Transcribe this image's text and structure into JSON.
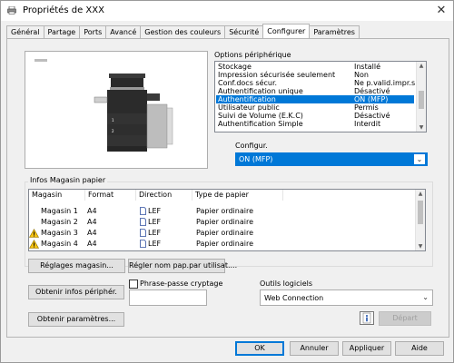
{
  "window": {
    "title": "Propriétés de XXX",
    "close_glyph": "✕"
  },
  "tabs": [
    "Général",
    "Partage",
    "Ports",
    "Avancé",
    "Gestion des couleurs",
    "Sécurité",
    "Configurer",
    "Paramètres"
  ],
  "active_tab": "Configurer",
  "options": {
    "label": "Options périphérique",
    "rows": [
      {
        "name": "Stockage",
        "value": "Installé"
      },
      {
        "name": "Impression sécurisée seulement",
        "value": "Non"
      },
      {
        "name": "Conf.docs sécur.",
        "value": "Ne p.valid.impr.s..."
      },
      {
        "name": "Authentification unique",
        "value": "Désactivé"
      },
      {
        "name": "Authentification",
        "value": "ON (MFP)"
      },
      {
        "name": "Utilisateur public",
        "value": "Permis"
      },
      {
        "name": "Suivi de Volume (E.K.C)",
        "value": "Désactivé"
      },
      {
        "name": "Authentification Simple",
        "value": "Interdit"
      }
    ],
    "selected_index": 4
  },
  "configure": {
    "label": "Configur.",
    "value": "ON (MFP)"
  },
  "trays": {
    "label": "Infos Magasin papier",
    "columns": [
      "Magasin",
      "Format",
      "Direction",
      "Type de papier"
    ],
    "rows": [
      {
        "tray": "Magasin 1",
        "format": "A4",
        "direction": "LEF",
        "type": "Papier ordinaire",
        "warning": false
      },
      {
        "tray": "Magasin 2",
        "format": "A4",
        "direction": "LEF",
        "type": "Papier ordinaire",
        "warning": false
      },
      {
        "tray": "Magasin 3",
        "format": "A4",
        "direction": "LEF",
        "type": "Papier ordinaire",
        "warning": true
      },
      {
        "tray": "Magasin 4",
        "format": "A4",
        "direction": "LEF",
        "type": "Papier ordinaire",
        "warning": true
      }
    ]
  },
  "buttons": {
    "tray_settings": "Réglages magasin...",
    "user_paper_name": "Régler nom pap.par utilisat....",
    "get_device_info": "Obtenir infos périphér.",
    "get_settings": "Obtenir paramètres...",
    "start": "Départ",
    "ok": "OK",
    "cancel": "Annuler",
    "apply": "Appliquer",
    "help": "Aide"
  },
  "passphrase": {
    "label": "Phrase-passe cryptage",
    "checked": false,
    "value": ""
  },
  "software_tools": {
    "label": "Outils logiciels",
    "value": "Web Connection"
  },
  "icons": {
    "info": "info-icon",
    "warning": "warning-icon",
    "paper": "paper-icon",
    "printer": "printer-icon"
  }
}
